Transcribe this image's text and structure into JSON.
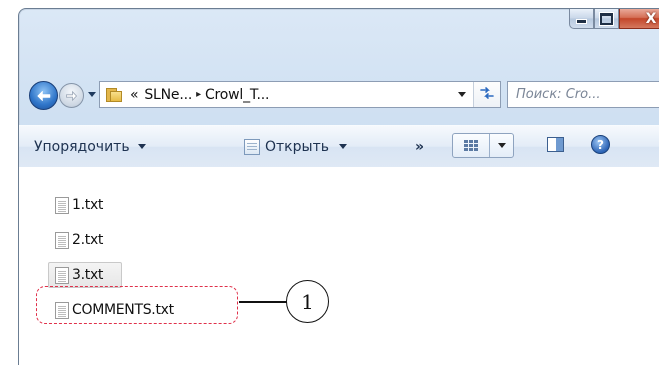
{
  "window": {
    "caption": {
      "minimize_icon": "minimize-icon",
      "maximize_icon": "maximize-icon",
      "close_glyph": "X"
    }
  },
  "navigation": {
    "back_icon": "back-arrow-icon",
    "forward_icon": "forward-arrow-icon",
    "address": {
      "crumb_prefix": "«",
      "crumbs": [
        "SLNe...",
        "Crowl_T..."
      ],
      "separator": "▸"
    },
    "refresh_icon": "refresh-icon",
    "search_placeholder": "Поиск: Cro..."
  },
  "toolbar": {
    "organize_label": "Упорядочить",
    "open_label": "Открыть",
    "more_label": "»",
    "help_glyph": "?"
  },
  "files": [
    {
      "name": "1.txt"
    },
    {
      "name": "2.txt"
    },
    {
      "name": "3.txt",
      "selected": true
    },
    {
      "name": "COMMENTS.txt"
    }
  ],
  "callout": {
    "number": "1"
  },
  "colors": {
    "callout_border": "#e0304a",
    "close_button": "#c3462a",
    "accent": "#2f75c9"
  }
}
